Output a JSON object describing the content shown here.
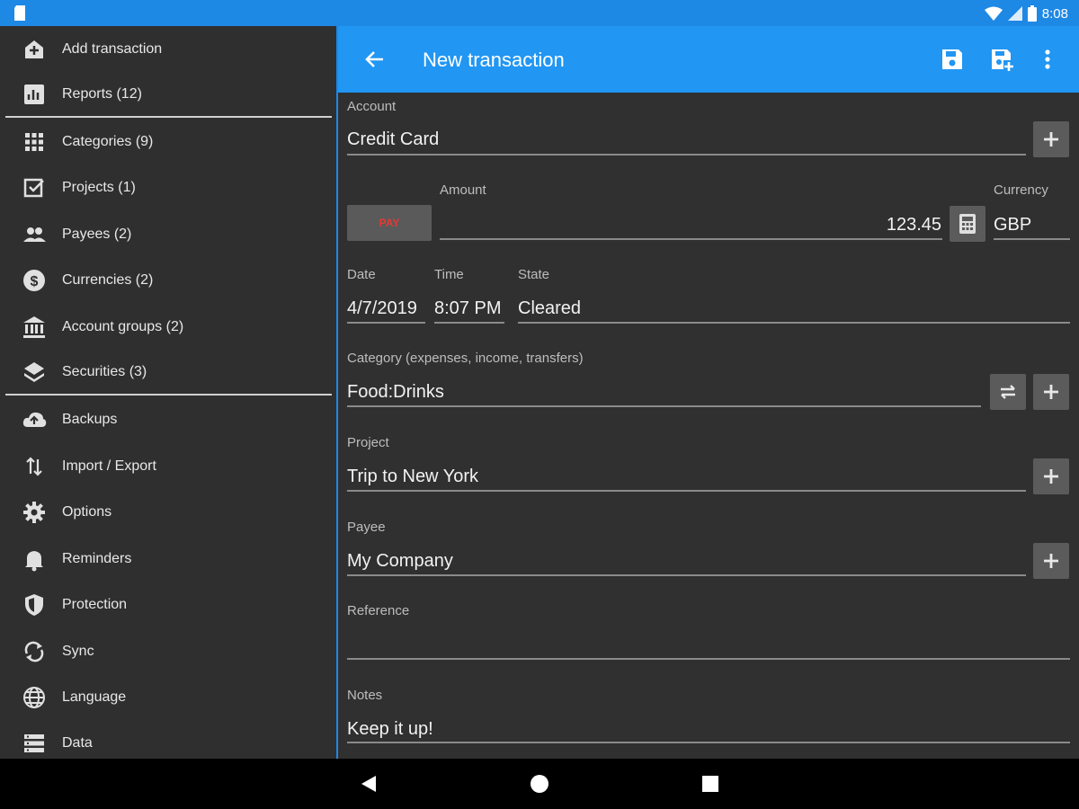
{
  "status_bar": {
    "time": "8:08"
  },
  "sidebar": {
    "items": [
      {
        "label": "Add transaction",
        "icon": "add-transaction-icon"
      },
      {
        "label": "Reports (12)",
        "icon": "reports-icon"
      },
      {
        "label": "Categories (9)",
        "icon": "grid-icon"
      },
      {
        "label": "Projects (1)",
        "icon": "checkbox-icon"
      },
      {
        "label": "Payees (2)",
        "icon": "people-icon"
      },
      {
        "label": "Currencies (2)",
        "icon": "dollar-icon"
      },
      {
        "label": "Account groups (2)",
        "icon": "bank-icon"
      },
      {
        "label": "Securities (3)",
        "icon": "layers-icon"
      },
      {
        "label": "Backups",
        "icon": "cloud-upload-icon"
      },
      {
        "label": "Import / Export",
        "icon": "import-export-icon"
      },
      {
        "label": "Options",
        "icon": "gear-icon"
      },
      {
        "label": "Reminders",
        "icon": "bell-icon"
      },
      {
        "label": "Protection",
        "icon": "shield-icon"
      },
      {
        "label": "Sync",
        "icon": "sync-icon"
      },
      {
        "label": "Language",
        "icon": "globe-icon"
      },
      {
        "label": "Data",
        "icon": "list-icon"
      }
    ]
  },
  "appbar": {
    "title": "New transaction"
  },
  "form": {
    "account_label": "Account",
    "account_value": "Credit Card",
    "pay_label": "PAY",
    "amount_label": "Amount",
    "amount_value": "123.45",
    "currency_label": "Currency",
    "currency_value": "GBP",
    "date_label": "Date",
    "date_value": "4/7/2019",
    "time_label": "Time",
    "time_value": "8:07 PM",
    "state_label": "State",
    "state_value": "Cleared",
    "category_label": "Category (expenses, income, transfers)",
    "category_value": "Food:Drinks",
    "project_label": "Project",
    "project_value": "Trip to New York",
    "payee_label": "Payee",
    "payee_value": "My Company",
    "reference_label": "Reference",
    "reference_value": "",
    "notes_label": "Notes",
    "notes_value": "Keep it up!"
  },
  "colors": {
    "accent": "#2196f3",
    "status_bar": "#1e88e5",
    "background": "#303030",
    "pay_text": "#e53935"
  }
}
